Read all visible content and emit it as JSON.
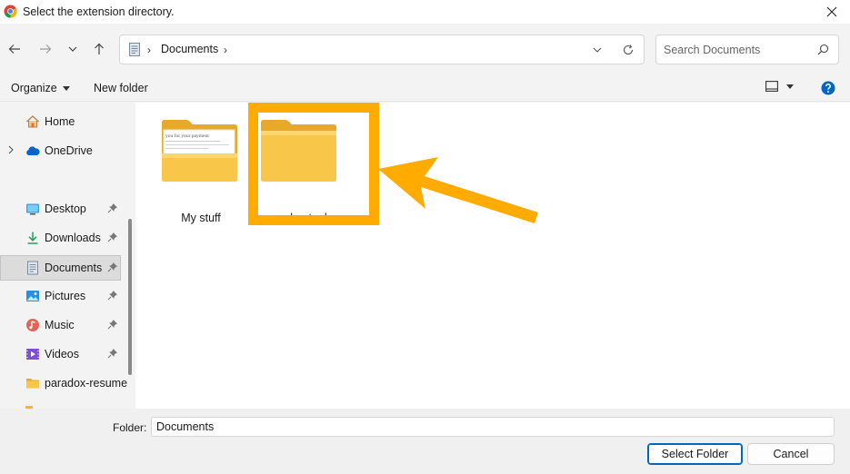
{
  "window": {
    "title": "Select the extension directory.",
    "close_glyph": "✕"
  },
  "address": {
    "separator": "›",
    "path": "Documents",
    "trailing_separator": "›"
  },
  "search": {
    "placeholder": "Search Documents"
  },
  "commands": {
    "organize": "Organize",
    "new_folder": "New folder"
  },
  "sidebar": {
    "items": [
      {
        "label": "Home",
        "icon": "home-icon"
      },
      {
        "label": "OneDrive",
        "icon": "cloud-icon"
      },
      {
        "label": "Desktop",
        "icon": "desktop-icon"
      },
      {
        "label": "Downloads",
        "icon": "download-icon"
      },
      {
        "label": "Documents",
        "icon": "document-icon",
        "selected": true
      },
      {
        "label": "Pictures",
        "icon": "pictures-icon"
      },
      {
        "label": "Music",
        "icon": "music-icon"
      },
      {
        "label": "Videos",
        "icon": "video-icon"
      },
      {
        "label": "paradox-resume",
        "icon": "folder-icon"
      }
    ]
  },
  "files": [
    {
      "name": "My stuff",
      "preview_text": "you for your payment"
    },
    {
      "name": "paradox-tools"
    }
  ],
  "footer": {
    "folder_label": "Folder:",
    "folder_value": "Documents",
    "select_button": "Select Folder",
    "cancel_button": "Cancel"
  },
  "colors": {
    "highlight": "#ffab00",
    "accent": "#0067c0",
    "folder": "#f8c74a"
  }
}
